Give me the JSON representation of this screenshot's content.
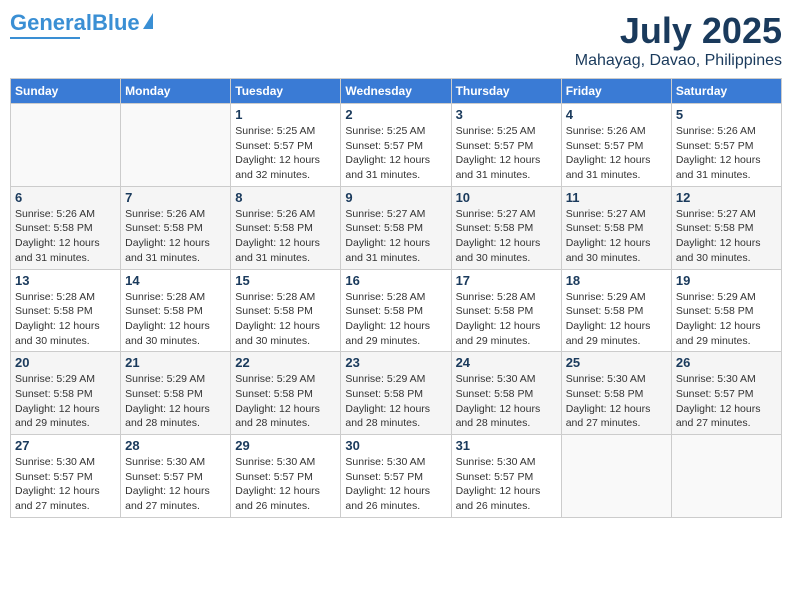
{
  "logo": {
    "text1": "General",
    "text2": "Blue"
  },
  "title": {
    "month_year": "July 2025",
    "location": "Mahayag, Davao, Philippines"
  },
  "headers": [
    "Sunday",
    "Monday",
    "Tuesday",
    "Wednesday",
    "Thursday",
    "Friday",
    "Saturday"
  ],
  "weeks": [
    [
      {
        "day": "",
        "detail": ""
      },
      {
        "day": "",
        "detail": ""
      },
      {
        "day": "1",
        "detail": "Sunrise: 5:25 AM\nSunset: 5:57 PM\nDaylight: 12 hours\nand 32 minutes."
      },
      {
        "day": "2",
        "detail": "Sunrise: 5:25 AM\nSunset: 5:57 PM\nDaylight: 12 hours\nand 31 minutes."
      },
      {
        "day": "3",
        "detail": "Sunrise: 5:25 AM\nSunset: 5:57 PM\nDaylight: 12 hours\nand 31 minutes."
      },
      {
        "day": "4",
        "detail": "Sunrise: 5:26 AM\nSunset: 5:57 PM\nDaylight: 12 hours\nand 31 minutes."
      },
      {
        "day": "5",
        "detail": "Sunrise: 5:26 AM\nSunset: 5:57 PM\nDaylight: 12 hours\nand 31 minutes."
      }
    ],
    [
      {
        "day": "6",
        "detail": "Sunrise: 5:26 AM\nSunset: 5:58 PM\nDaylight: 12 hours\nand 31 minutes."
      },
      {
        "day": "7",
        "detail": "Sunrise: 5:26 AM\nSunset: 5:58 PM\nDaylight: 12 hours\nand 31 minutes."
      },
      {
        "day": "8",
        "detail": "Sunrise: 5:26 AM\nSunset: 5:58 PM\nDaylight: 12 hours\nand 31 minutes."
      },
      {
        "day": "9",
        "detail": "Sunrise: 5:27 AM\nSunset: 5:58 PM\nDaylight: 12 hours\nand 31 minutes."
      },
      {
        "day": "10",
        "detail": "Sunrise: 5:27 AM\nSunset: 5:58 PM\nDaylight: 12 hours\nand 30 minutes."
      },
      {
        "day": "11",
        "detail": "Sunrise: 5:27 AM\nSunset: 5:58 PM\nDaylight: 12 hours\nand 30 minutes."
      },
      {
        "day": "12",
        "detail": "Sunrise: 5:27 AM\nSunset: 5:58 PM\nDaylight: 12 hours\nand 30 minutes."
      }
    ],
    [
      {
        "day": "13",
        "detail": "Sunrise: 5:28 AM\nSunset: 5:58 PM\nDaylight: 12 hours\nand 30 minutes."
      },
      {
        "day": "14",
        "detail": "Sunrise: 5:28 AM\nSunset: 5:58 PM\nDaylight: 12 hours\nand 30 minutes."
      },
      {
        "day": "15",
        "detail": "Sunrise: 5:28 AM\nSunset: 5:58 PM\nDaylight: 12 hours\nand 30 minutes."
      },
      {
        "day": "16",
        "detail": "Sunrise: 5:28 AM\nSunset: 5:58 PM\nDaylight: 12 hours\nand 29 minutes."
      },
      {
        "day": "17",
        "detail": "Sunrise: 5:28 AM\nSunset: 5:58 PM\nDaylight: 12 hours\nand 29 minutes."
      },
      {
        "day": "18",
        "detail": "Sunrise: 5:29 AM\nSunset: 5:58 PM\nDaylight: 12 hours\nand 29 minutes."
      },
      {
        "day": "19",
        "detail": "Sunrise: 5:29 AM\nSunset: 5:58 PM\nDaylight: 12 hours\nand 29 minutes."
      }
    ],
    [
      {
        "day": "20",
        "detail": "Sunrise: 5:29 AM\nSunset: 5:58 PM\nDaylight: 12 hours\nand 29 minutes."
      },
      {
        "day": "21",
        "detail": "Sunrise: 5:29 AM\nSunset: 5:58 PM\nDaylight: 12 hours\nand 28 minutes."
      },
      {
        "day": "22",
        "detail": "Sunrise: 5:29 AM\nSunset: 5:58 PM\nDaylight: 12 hours\nand 28 minutes."
      },
      {
        "day": "23",
        "detail": "Sunrise: 5:29 AM\nSunset: 5:58 PM\nDaylight: 12 hours\nand 28 minutes."
      },
      {
        "day": "24",
        "detail": "Sunrise: 5:30 AM\nSunset: 5:58 PM\nDaylight: 12 hours\nand 28 minutes."
      },
      {
        "day": "25",
        "detail": "Sunrise: 5:30 AM\nSunset: 5:58 PM\nDaylight: 12 hours\nand 27 minutes."
      },
      {
        "day": "26",
        "detail": "Sunrise: 5:30 AM\nSunset: 5:57 PM\nDaylight: 12 hours\nand 27 minutes."
      }
    ],
    [
      {
        "day": "27",
        "detail": "Sunrise: 5:30 AM\nSunset: 5:57 PM\nDaylight: 12 hours\nand 27 minutes."
      },
      {
        "day": "28",
        "detail": "Sunrise: 5:30 AM\nSunset: 5:57 PM\nDaylight: 12 hours\nand 27 minutes."
      },
      {
        "day": "29",
        "detail": "Sunrise: 5:30 AM\nSunset: 5:57 PM\nDaylight: 12 hours\nand 26 minutes."
      },
      {
        "day": "30",
        "detail": "Sunrise: 5:30 AM\nSunset: 5:57 PM\nDaylight: 12 hours\nand 26 minutes."
      },
      {
        "day": "31",
        "detail": "Sunrise: 5:30 AM\nSunset: 5:57 PM\nDaylight: 12 hours\nand 26 minutes."
      },
      {
        "day": "",
        "detail": ""
      },
      {
        "day": "",
        "detail": ""
      }
    ]
  ]
}
